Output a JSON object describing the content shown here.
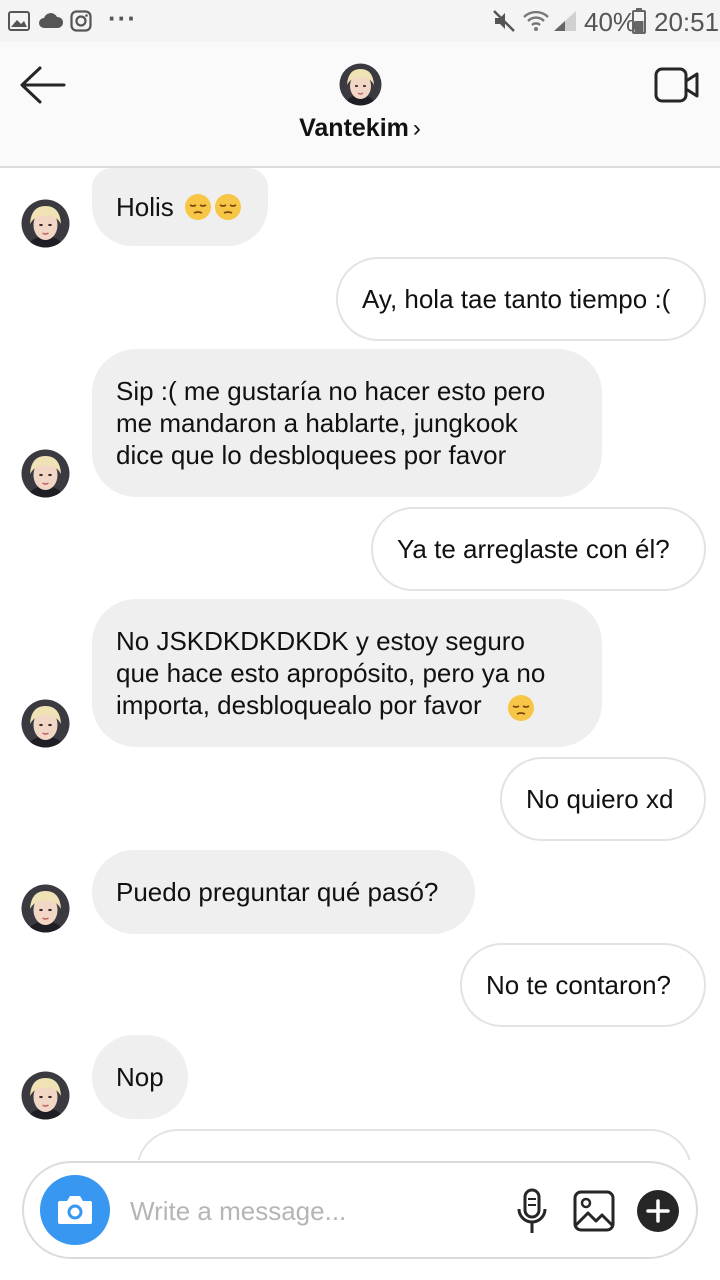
{
  "status_bar": {
    "battery_percent": "40%",
    "time": "20:51",
    "more": "···"
  },
  "header": {
    "username": "Vantekim",
    "chevron": "›"
  },
  "messages": [
    {
      "side": "in",
      "text": "Holis",
      "emoji": [
        "pensive-emoji",
        "pensive-emoji"
      ]
    },
    {
      "side": "out",
      "text": "Ay, hola tae tanto tiempo :("
    },
    {
      "side": "in",
      "text": "Sip :( me gustaría no hacer esto pero\nme mandaron a hablarte, jungkook\ndice que lo desbloquees por favor"
    },
    {
      "side": "out",
      "text": "Ya te arreglaste con él?"
    },
    {
      "side": "in",
      "text": "No JSKDKDKDKDK y estoy seguro\nque hace esto apropósito, pero ya no\nimporta, desbloquealo por favor",
      "emoji": [
        "pensive-emoji"
      ]
    },
    {
      "side": "out",
      "text": "No quiero xd"
    },
    {
      "side": "in",
      "text": "Puedo preguntar qué pasó?"
    },
    {
      "side": "out",
      "text": "No te contaron?"
    },
    {
      "side": "in",
      "text": "Nop"
    }
  ],
  "composer": {
    "placeholder": "Write a message..."
  },
  "colors": {
    "accent": "#3897f0",
    "incoming_bubble": "#efefef",
    "outgoing_border": "#e3e3e3"
  },
  "icons": [
    "image-icon",
    "cloud-icon",
    "instagram-icon",
    "mute-icon",
    "wifi-icon",
    "signal-icon",
    "battery-icon",
    "back-arrow-icon",
    "video-camera-icon",
    "camera-icon",
    "microphone-icon",
    "gallery-icon",
    "plus-icon"
  ]
}
